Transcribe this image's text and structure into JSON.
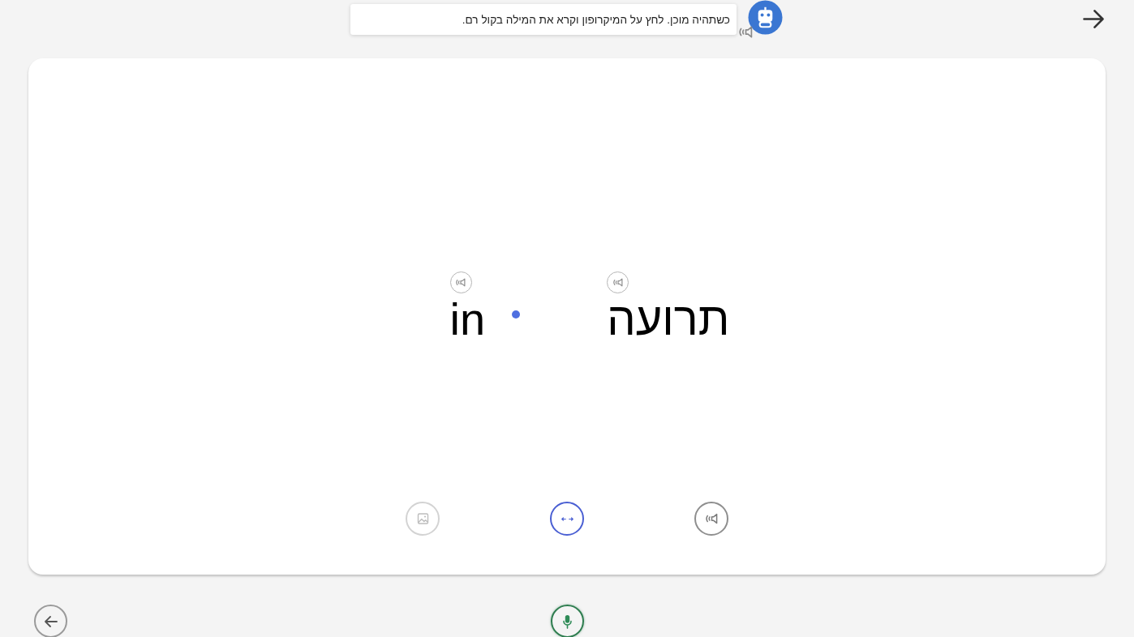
{
  "prompt": {
    "text": "כשתהיה מוכן. לחץ על המיקרופון וקרא את המילה בקול רם."
  },
  "card": {
    "words": [
      {
        "text": "תרועה"
      },
      {
        "text": "in"
      }
    ],
    "actions": [
      {
        "kind": "image",
        "disabled": true
      },
      {
        "kind": "swap",
        "disabled": false
      },
      {
        "kind": "audio",
        "disabled": false
      }
    ]
  },
  "footer": {
    "buttons": [
      {
        "kind": "back"
      },
      {
        "kind": "mic"
      }
    ]
  }
}
